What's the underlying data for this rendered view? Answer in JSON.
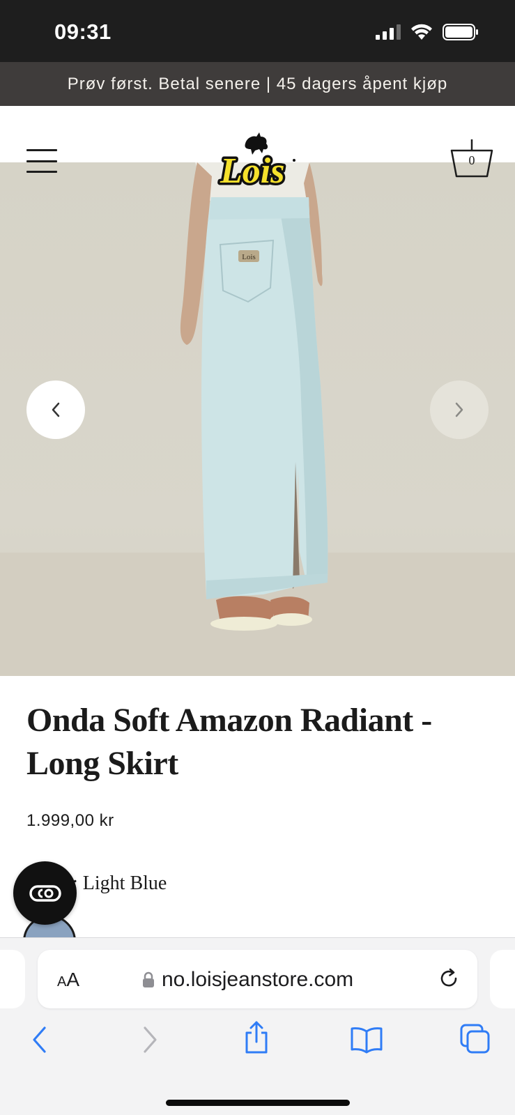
{
  "status_bar": {
    "time": "09:31"
  },
  "promo_banner": {
    "text": "Prøv først. Betal senere | 45 dagers åpent kjøp"
  },
  "header": {
    "logo_text": "Lois",
    "cart_count": "0"
  },
  "product": {
    "title": "Onda Soft Amazon Radiant - Long Skirt",
    "price": "1.999,00 kr",
    "color_prefix": ":",
    "color_value": "Light Blue",
    "pocket_label": "Lois"
  },
  "browser": {
    "text_size_label_small": "A",
    "text_size_label_large": "A",
    "url": "no.loisjeanstore.com"
  },
  "colors": {
    "status_bar_bg": "#1e1e1e",
    "promo_bg": "#3f3c3b",
    "logo_yellow": "#f5e12c",
    "skirt_blue": "#cde4e6",
    "safari_blue": "#2f7cf6"
  },
  "icons": [
    "signal-icon",
    "wifi-icon",
    "battery-icon",
    "menu-icon",
    "search-icon",
    "basket-icon",
    "chevron-left-icon",
    "chevron-right-icon",
    "chat-icon",
    "lock-icon",
    "reload-icon",
    "back-icon",
    "forward-icon",
    "share-icon",
    "bookmarks-icon",
    "tabs-icon"
  ]
}
